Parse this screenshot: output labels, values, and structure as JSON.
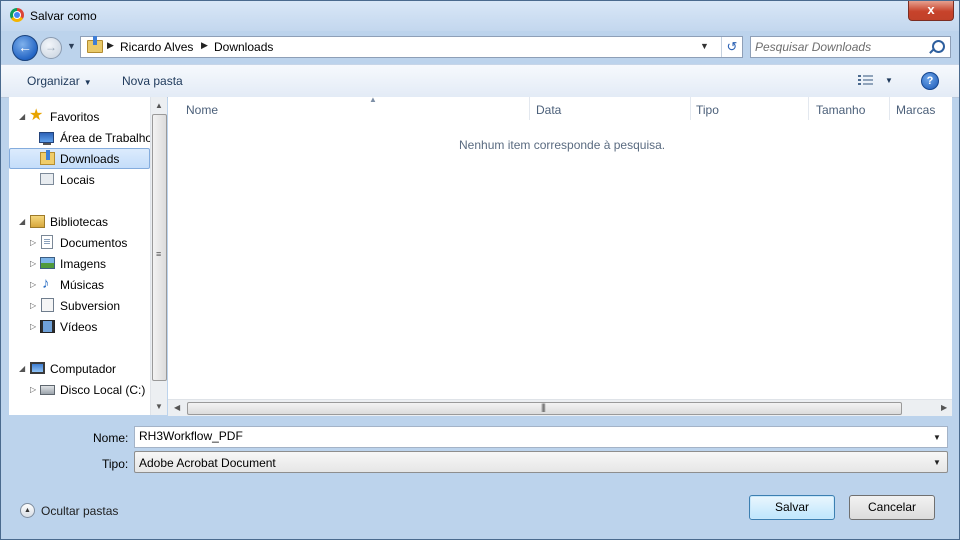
{
  "window": {
    "title": "Salvar como",
    "close_glyph": "x"
  },
  "nav": {
    "breadcrumb": [
      "Ricardo Alves",
      "Downloads"
    ],
    "search": {
      "placeholder": "Pesquisar Downloads",
      "value": ""
    }
  },
  "toolbar": {
    "organize": "Organizar",
    "new_folder": "Nova pasta",
    "help": "?"
  },
  "sidebar": {
    "items": [
      {
        "label": "Favoritos",
        "icon": "star-icon"
      },
      {
        "label": "Área de Trabalho",
        "icon": "desktop-icon"
      },
      {
        "label": "Downloads",
        "icon": "downloads-folder-icon",
        "selected": true
      },
      {
        "label": "Locais",
        "icon": "places-icon"
      },
      {
        "label": "Bibliotecas",
        "icon": "libraries-icon"
      },
      {
        "label": "Documentos",
        "icon": "documents-icon"
      },
      {
        "label": "Imagens",
        "icon": "pictures-icon"
      },
      {
        "label": "Músicas",
        "icon": "music-icon"
      },
      {
        "label": "Subversion",
        "icon": "subversion-icon"
      },
      {
        "label": "Vídeos",
        "icon": "videos-icon"
      },
      {
        "label": "Computador",
        "icon": "computer-icon"
      },
      {
        "label": "Disco Local (C:)",
        "icon": "local-disk-icon"
      }
    ]
  },
  "file_list": {
    "columns": [
      "Nome",
      "Data",
      "Tipo",
      "Tamanho",
      "Marcas"
    ],
    "empty_message": "Nenhum item corresponde à pesquisa."
  },
  "form": {
    "name_label": "Nome:",
    "name_value": "RH3Workflow_PDF",
    "type_label": "Tipo:",
    "type_value": "Adobe Acrobat Document"
  },
  "footer": {
    "hide_folders": "Ocultar pastas",
    "save": "Salvar",
    "cancel": "Cancelar"
  },
  "colors": {
    "accent": "#2566c5",
    "close": "#c7432b",
    "selection": "#c4ddfa"
  }
}
